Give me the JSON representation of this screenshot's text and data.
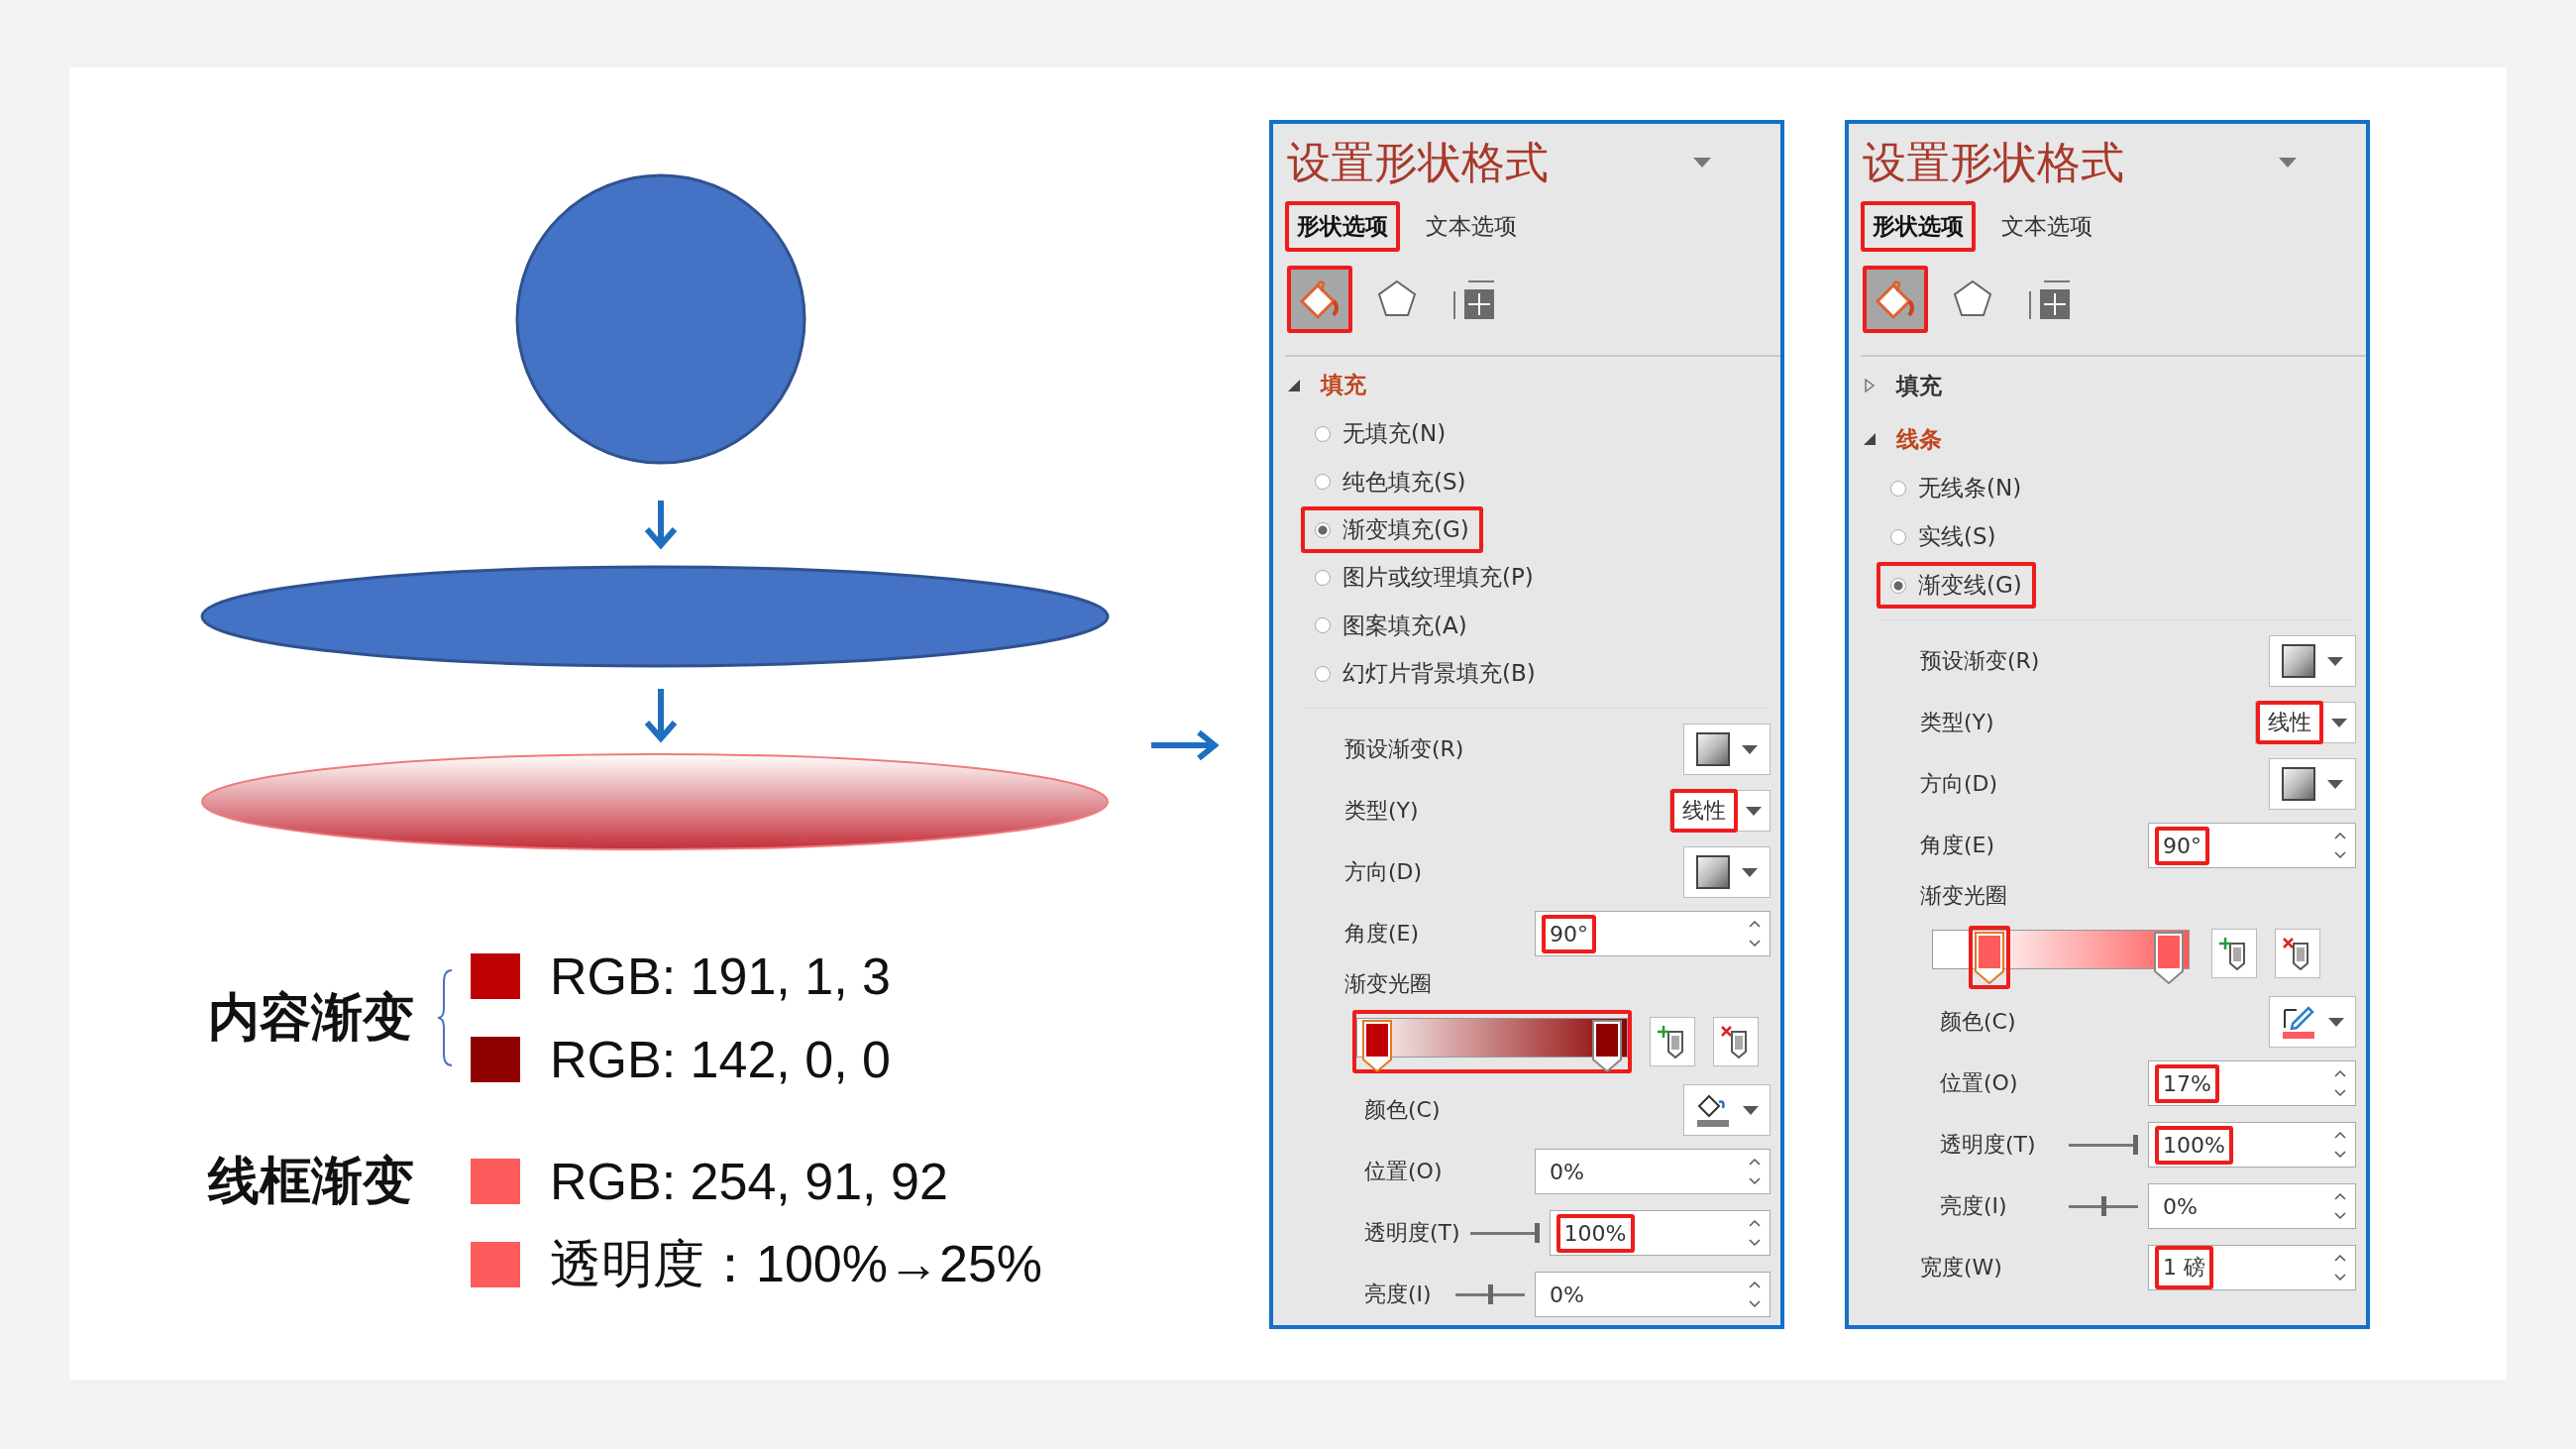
{
  "legend": [
    {
      "label": "内容渐变",
      "brace": true,
      "items": [
        {
          "color": "#bf0103",
          "text": "RGB: 191, 1, 3"
        },
        {
          "color": "#8e0000",
          "text": "RGB: 142, 0, 0"
        }
      ]
    },
    {
      "label": "线框渐变",
      "brace": false,
      "items": [
        {
          "color": "#fe5b5c",
          "text": "RGB: 254, 91, 92"
        },
        {
          "color": "#fe5b5c",
          "text": "透明度：100%→25%"
        }
      ]
    }
  ],
  "panels": [
    {
      "title": "设置形状格式",
      "tabs": [
        {
          "label": "形状选项",
          "selected": true,
          "highlighted": true
        },
        {
          "label": "文本选项",
          "selected": false,
          "highlighted": false
        }
      ],
      "icon_tabs": [
        {
          "kind": "fill",
          "selected": true,
          "highlighted": true
        },
        {
          "kind": "effects",
          "selected": false,
          "highlighted": false
        },
        {
          "kind": "size",
          "selected": false,
          "highlighted": false
        }
      ],
      "sections": [
        {
          "label": "填充",
          "expanded": true,
          "options": [
            {
              "label": "无填充(N)",
              "selected": false,
              "highlighted": false
            },
            {
              "label": "纯色填充(S)",
              "selected": false,
              "highlighted": false
            },
            {
              "label": "渐变填充(G)",
              "selected": true,
              "highlighted": true
            },
            {
              "label": "图片或纹理填充(P)",
              "selected": false,
              "highlighted": false
            },
            {
              "label": "图案填充(A)",
              "selected": false,
              "highlighted": false
            },
            {
              "label": "幻灯片背景填充(B)",
              "selected": false,
              "highlighted": false
            }
          ]
        }
      ],
      "rows": [
        {
          "kind": "swatch",
          "label": "预设渐变(R)",
          "sub": false
        },
        {
          "kind": "select",
          "label": "类型(Y)",
          "value": "线性",
          "sub": false,
          "highlighted": true
        },
        {
          "kind": "swatch",
          "label": "方向(D)",
          "sub": false
        },
        {
          "kind": "spin",
          "label": "角度(E)",
          "value": "90°",
          "sub": false,
          "highlighted": true
        },
        {
          "kind": "heading",
          "label": "渐变光圈",
          "sub": false
        },
        {
          "kind": "stops",
          "sub": false,
          "highlighted": true,
          "stops": [
            {
              "level": 0,
              "color": "#bf0103",
              "selected": true,
              "highlighted": false
            },
            {
              "level": 1,
              "color": "#8e0000",
              "selected": false,
              "highlighted": false
            }
          ]
        },
        {
          "kind": "fill-color",
          "label": "颜色(C)",
          "sub": true
        },
        {
          "kind": "spin",
          "label": "位置(O)",
          "value": "0%",
          "sub": true,
          "highlighted": false
        },
        {
          "kind": "spin",
          "label": "透明度(T)",
          "value": "100%",
          "level": 1,
          "sub": true,
          "highlighted": true
        },
        {
          "kind": "spin",
          "label": "亮度(I)",
          "value": "0%",
          "level": 0.5,
          "sub": true,
          "highlighted": false
        }
      ]
    },
    {
      "title": "设置形状格式",
      "tabs": [
        {
          "label": "形状选项",
          "selected": true,
          "highlighted": true
        },
        {
          "label": "文本选项",
          "selected": false,
          "highlighted": false
        }
      ],
      "icon_tabs": [
        {
          "kind": "fill",
          "selected": true,
          "highlighted": true
        },
        {
          "kind": "effects",
          "selected": false,
          "highlighted": false
        },
        {
          "kind": "size",
          "selected": false,
          "highlighted": false
        }
      ],
      "sections": [
        {
          "label": "填充",
          "expanded": false
        },
        {
          "label": "线条",
          "expanded": true,
          "options": [
            {
              "label": "无线条(N)",
              "selected": false,
              "highlighted": false
            },
            {
              "label": "实线(S)",
              "selected": false,
              "highlighted": false
            },
            {
              "label": "渐变线(G)",
              "selected": true,
              "highlighted": true
            }
          ]
        }
      ],
      "rows": [
        {
          "kind": "swatch",
          "label": "预设渐变(R)",
          "sub": false
        },
        {
          "kind": "select",
          "label": "类型(Y)",
          "value": "线性",
          "sub": false,
          "highlighted": true
        },
        {
          "kind": "swatch",
          "label": "方向(D)",
          "sub": false
        },
        {
          "kind": "spin",
          "label": "角度(E)",
          "value": "90°",
          "sub": false,
          "highlighted": true
        },
        {
          "kind": "heading",
          "label": "渐变光圈",
          "sub": false
        },
        {
          "kind": "stops",
          "sub": false,
          "highlighted": false,
          "stops": [
            {
              "level": 0.17,
              "color": "#fe5b5c",
              "selected": true,
              "highlighted": true
            },
            {
              "level": 1,
              "color": "#fe5b5c",
              "selected": false,
              "highlighted": false
            }
          ]
        },
        {
          "kind": "line-color",
          "label": "颜色(C)",
          "sub": true
        },
        {
          "kind": "spin",
          "label": "位置(O)",
          "value": "17%",
          "sub": true,
          "highlighted": true
        },
        {
          "kind": "spin",
          "label": "透明度(T)",
          "value": "100%",
          "level": 1,
          "sub": true,
          "highlighted": true
        },
        {
          "kind": "spin",
          "label": "亮度(I)",
          "value": "0%",
          "level": 0.5,
          "sub": true,
          "highlighted": false
        },
        {
          "kind": "spin",
          "label": "宽度(W)",
          "value": "1 磅",
          "sub": false,
          "highlighted": true
        }
      ]
    }
  ]
}
